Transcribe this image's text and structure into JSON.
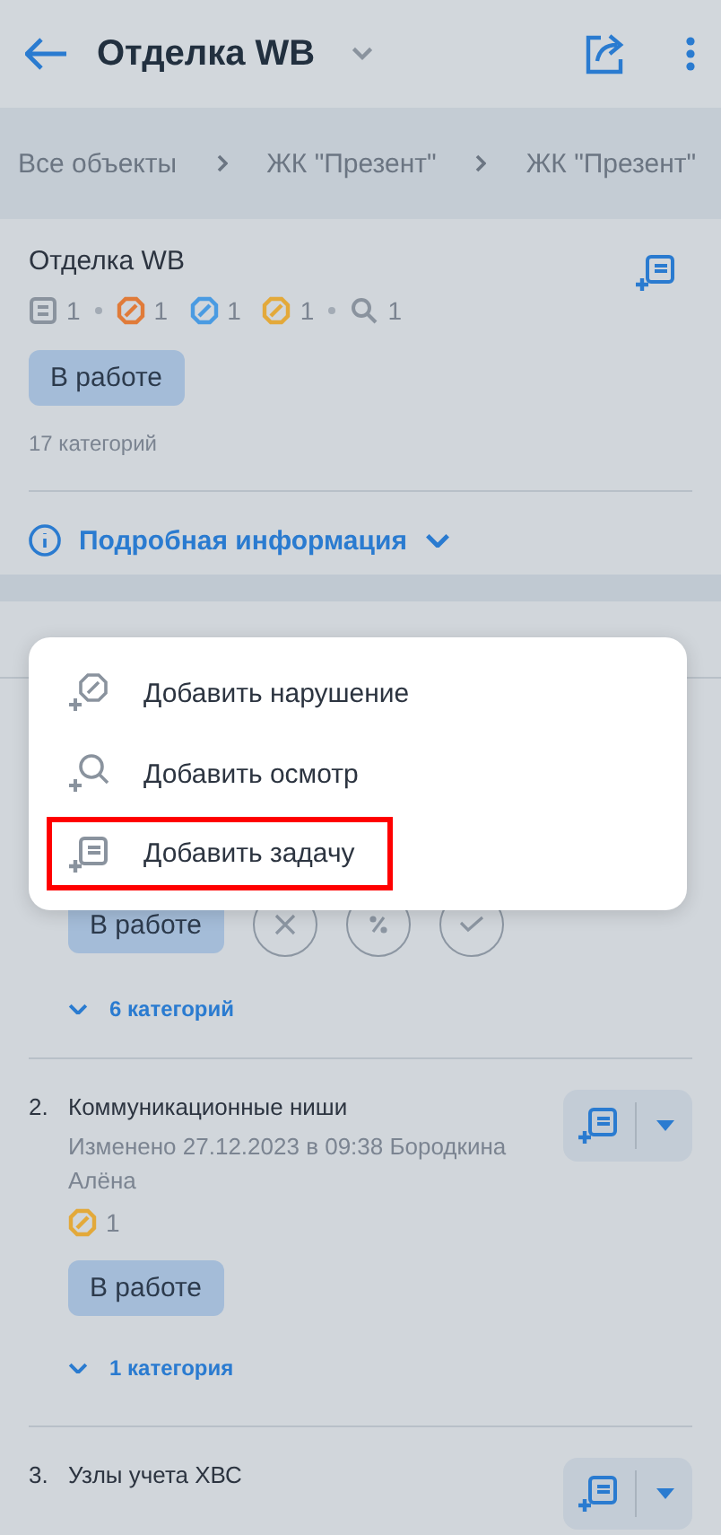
{
  "header": {
    "title": "Отделка WB"
  },
  "breadcrumbs": [
    "Все объекты",
    "ЖК \"Презент\"",
    "ЖК \"Презент\""
  ],
  "card": {
    "title": "Отделка WB",
    "counters": [
      {
        "kind": "task",
        "count": "1"
      },
      {
        "kind": "violation",
        "color": "#e07b39",
        "count": "1"
      },
      {
        "kind": "violation",
        "color": "#4a9be2",
        "count": "1"
      },
      {
        "kind": "violation",
        "color": "#e3a93a",
        "count": "1"
      },
      {
        "kind": "inspection",
        "count": "1"
      }
    ],
    "status": "В работе",
    "categories": "17 категорий",
    "details": "Подробная информация"
  },
  "sections": [
    {
      "status": "В работе",
      "review_buttons": true,
      "categories": "6 категорий"
    },
    {
      "number": "2.",
      "title": "Коммуникационные ниши",
      "meta": "Изменено 27.12.2023 в 09:38 Бородкина Алёна",
      "counters": [
        {
          "kind": "violation",
          "color": "#e3a93a",
          "count": "1"
        }
      ],
      "status": "В работе",
      "categories": "1 категория"
    },
    {
      "number": "3.",
      "title": "Узлы учета ХВС"
    }
  ],
  "menu": {
    "items": [
      {
        "kind": "violation",
        "label": "Добавить нарушение",
        "highlighted": false
      },
      {
        "kind": "inspection",
        "label": "Добавить осмотр",
        "highlighted": false
      },
      {
        "kind": "task",
        "label": "Добавить задачу",
        "highlighted": true
      }
    ]
  }
}
